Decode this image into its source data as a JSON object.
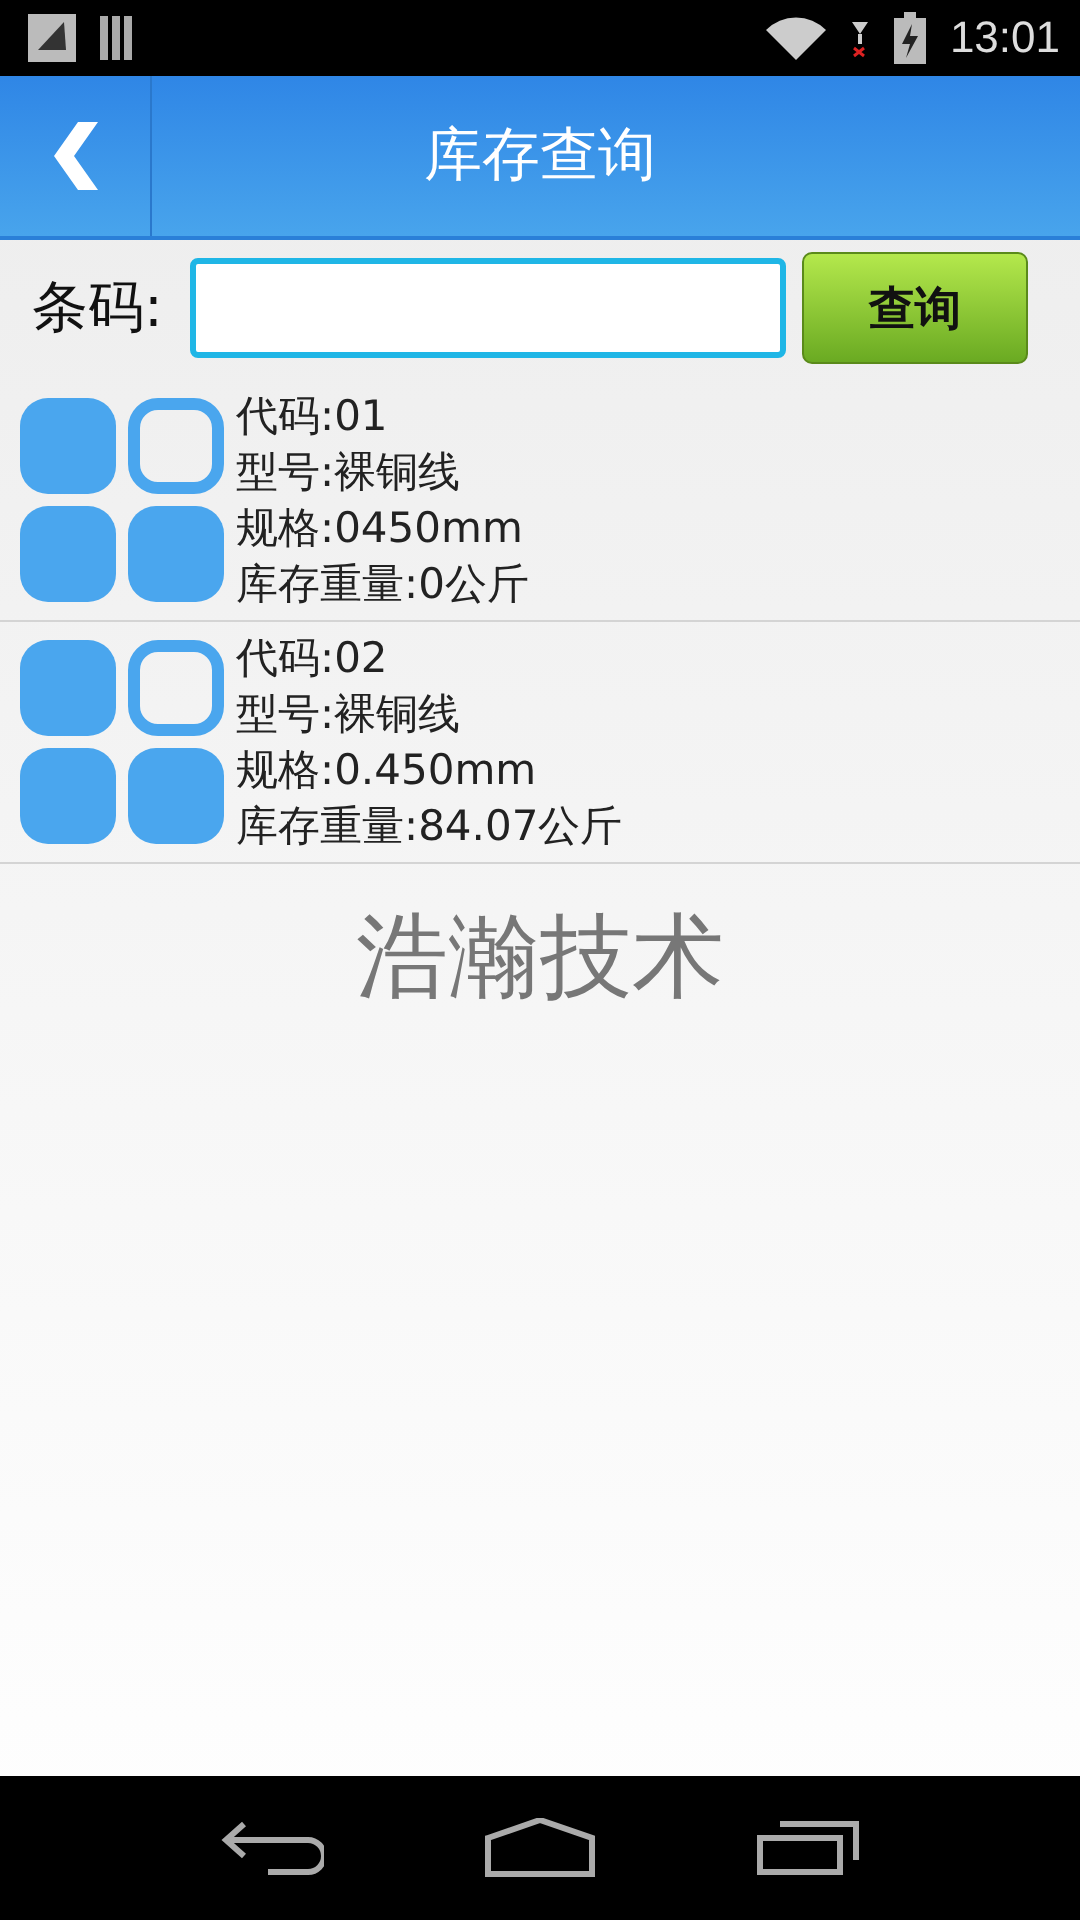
{
  "status_bar": {
    "time": "13:01"
  },
  "header": {
    "title": "库存查询"
  },
  "search": {
    "label": "条码:",
    "button": "查询"
  },
  "items": [
    {
      "lines": [
        "代码:01",
        "型号:裸铜线",
        "规格:0450mm",
        "库存重量:0公斤"
      ]
    },
    {
      "lines": [
        "代码:02",
        "型号:裸铜线",
        "规格:0.450mm",
        "库存重量:84.07公斤"
      ]
    }
  ],
  "footer": {
    "text": "浩瀚技术"
  }
}
